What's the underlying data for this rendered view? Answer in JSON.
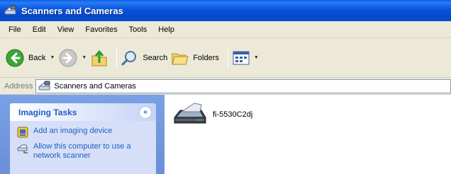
{
  "window": {
    "title": "Scanners and Cameras"
  },
  "menu": [
    "File",
    "Edit",
    "View",
    "Favorites",
    "Tools",
    "Help"
  ],
  "toolbar": {
    "back": "Back",
    "search": "Search",
    "folders": "Folders"
  },
  "address": {
    "label": "Address",
    "value": "Scanners and Cameras"
  },
  "tasks": {
    "title": "Imaging Tasks",
    "links": [
      "Add an imaging device",
      "Allow this computer to use a network scanner"
    ]
  },
  "devices": [
    "fi-5530C2dj"
  ]
}
